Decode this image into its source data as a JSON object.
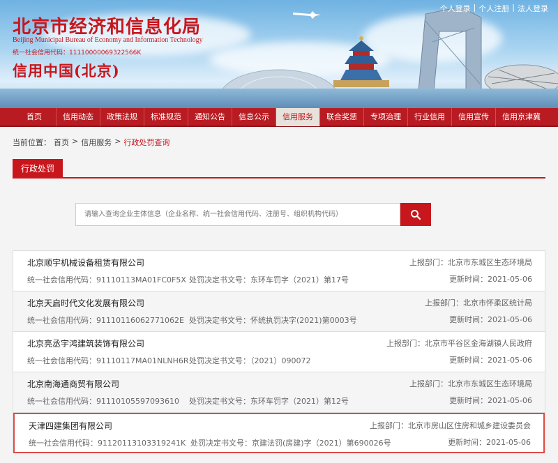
{
  "header": {
    "title": "北京市经济和信息化局",
    "subtitle": "Beijing Municipal Bureau of Economy and Information Technology",
    "credit_code": "统一社会信用代码：11110000069322566K",
    "brand": "信用中国(北京)",
    "links": [
      "个人登录",
      "个人注册",
      "法人登录"
    ]
  },
  "nav": {
    "items": [
      "首页",
      "信用动态",
      "政策法规",
      "标准规范",
      "通知公告",
      "信息公示",
      "信用服务",
      "联合奖惩",
      "专项治理",
      "行业信用",
      "信用宣传",
      "信用京津冀"
    ],
    "active_index": 6
  },
  "breadcrumb": {
    "label": "当前位置：",
    "home": "首页",
    "sep1": ">",
    "mid": "信用服务",
    "sep2": ">",
    "current": "行政处罚查询"
  },
  "tab": {
    "label": "行政处罚"
  },
  "search": {
    "placeholder": "请输入查询企业主体信息（企业名称、统一社会信用代码、注册号、组织机构代码）",
    "icon": "search-icon"
  },
  "records": [
    {
      "name": "北京顺宇机械设备租赁有限公司",
      "code": "统一社会信用代码：91110113MA01FC0F5X",
      "decision": "处罚决定书文号：东环车罚字（2021）第17号",
      "dept": "上报部门：北京市东城区生态环境局",
      "date": "更新时间：2021-05-06"
    },
    {
      "name": "北京天启时代文化发展有限公司",
      "code": "统一社会信用代码：91110116062771062E",
      "decision": "处罚决定书文号：怀统执罚决字(2021)第0003号",
      "dept": "上报部门：北京市怀柔区统计局",
      "date": "更新时间：2021-05-06"
    },
    {
      "name": "北京亮丞宇鸿建筑装饰有限公司",
      "code": "统一社会信用代码：91110117MA01NLNH6R",
      "decision": "处罚决定书文号：（2021）090072",
      "dept": "上报部门：北京市平谷区金海湖镇人民政府",
      "date": "更新时间：2021-05-06"
    },
    {
      "name": "北京南海通商贸有限公司",
      "code": "统一社会信用代码：91110105597093610",
      "decision": "处罚决定书文号：东环车罚字（2021）第12号",
      "dept": "上报部门：北京市东城区生态环境局",
      "date": "更新时间：2021-05-06"
    },
    {
      "name": "天津四建集团有限公司",
      "code": "统一社会信用代码：91120113103319241K",
      "decision": "处罚决定书文号：京建法罚(房建)字（2021）第690026号",
      "dept": "上报部门：北京市房山区住房和城乡建设委员会",
      "date": "更新时间：2021-05-06"
    }
  ],
  "colors": {
    "primary": "#c8161d",
    "nav_bg": "#b81c22",
    "highlight_border": "#e04a46"
  }
}
